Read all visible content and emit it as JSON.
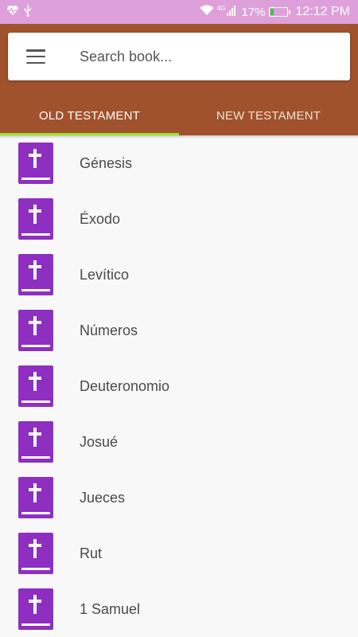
{
  "status_bar": {
    "network_label": "4G",
    "battery_percent": "17%",
    "time": "12:12 PM",
    "icons": [
      "heart-monitor-icon",
      "usb-icon",
      "wifi-icon",
      "signal-icon",
      "battery-icon"
    ]
  },
  "search": {
    "placeholder": "Search book..."
  },
  "tabs": [
    {
      "label": "OLD TESTAMENT",
      "active": true
    },
    {
      "label": "NEW TESTAMENT",
      "active": false
    }
  ],
  "books": [
    {
      "name": "Génesis"
    },
    {
      "name": "Éxodo"
    },
    {
      "name": "Levítico"
    },
    {
      "name": "Números"
    },
    {
      "name": "Deuteronomio"
    },
    {
      "name": "Josué"
    },
    {
      "name": "Jueces"
    },
    {
      "name": "Rut"
    },
    {
      "name": "1 Samuel"
    }
  ],
  "colors": {
    "status_bar": "#dea0da",
    "app_bar": "#a0522d",
    "tab_indicator": "#9be32a",
    "book_icon": "#8e2fc1"
  }
}
